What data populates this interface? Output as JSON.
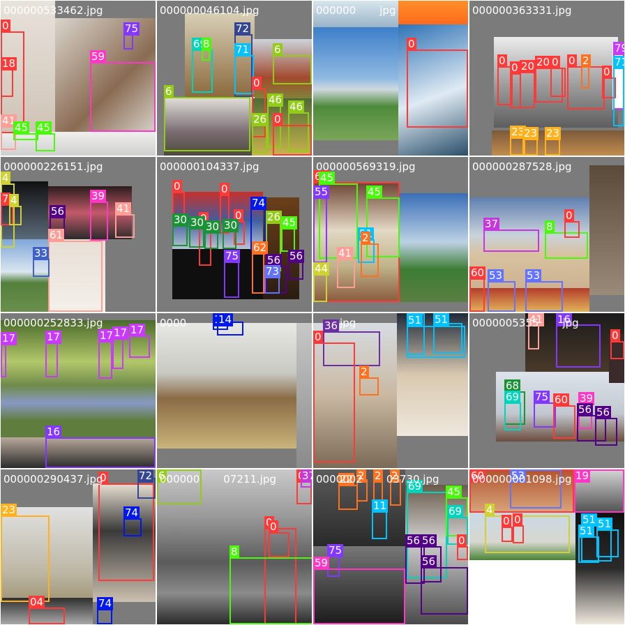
{
  "palette": {
    "0": "#ff3838",
    "2": "#ff701f",
    "4": "#cfd231",
    "6": "#92cc17",
    "8": "#48f90a",
    "14": "#0018ec",
    "16": "#8438ff",
    "17": "#cb38ff",
    "19": "#ff37c7",
    "22": "#ff701f",
    "23": "#ffb21d",
    "26": "#92cc17",
    "30": "#1a9334",
    "33": "#3d61c6",
    "36": "#6b2fa1",
    "37": "#c837de",
    "39": "#ff37c7",
    "41": "#ff9d97",
    "44": "#cfd231",
    "45": "#48f90a",
    "46": "#92cc17",
    "51": "#00c2ff",
    "53": "#6473ff",
    "55": "#8438ff",
    "56": "#520085",
    "59": "#ff37c7",
    "60": "#ff3838",
    "61": "#ff9d97",
    "62": "#ff701f",
    "68": "#1a9334",
    "69": "#00d4bb",
    "71": "#00c2ff",
    "72": "#344593",
    "73": "#6473ff",
    "74": "#0018ec",
    "75": "#8438ff",
    "79": "#cb38ff"
  },
  "tiles": [
    {
      "filename": "000000533462.jpg",
      "labels": [
        {
          "cls": "0",
          "text": "0"
        },
        {
          "cls": "75",
          "text": "75"
        },
        {
          "cls": "59",
          "text": "59"
        },
        {
          "cls": "41",
          "text": "41"
        },
        {
          "cls": "45",
          "text": "45"
        },
        {
          "cls": "45",
          "text": "45"
        },
        {
          "cls": "18",
          "text": "18"
        }
      ]
    },
    {
      "filename": "000000046104.jpg",
      "labels": [
        {
          "cls": "72",
          "text": "72"
        },
        {
          "cls": "71",
          "text": "71"
        },
        {
          "cls": "69",
          "text": "69"
        },
        {
          "cls": "8",
          "text": "8"
        },
        {
          "cls": "6",
          "text": "6"
        },
        {
          "cls": "6",
          "text": "6"
        },
        {
          "cls": "0",
          "text": "0"
        },
        {
          "cls": "46",
          "text": "46"
        },
        {
          "cls": "46",
          "text": "46"
        },
        {
          "cls": "26",
          "text": "26"
        },
        {
          "cls": "0",
          "text": "0"
        }
      ]
    },
    {
      "filename": "000000",
      "filename_tail": "jpg",
      "labels": [
        {
          "cls": "0",
          "text": "0"
        }
      ]
    },
    {
      "filename": "000000363331.jpg",
      "labels": [
        {
          "cls": "0",
          "text": "0"
        },
        {
          "cls": "0",
          "text": "0"
        },
        {
          "cls": "0",
          "text": "20"
        },
        {
          "cls": "0",
          "text": "20"
        },
        {
          "cls": "0",
          "text": "0"
        },
        {
          "cls": "0",
          "text": "0"
        },
        {
          "cls": "2",
          "text": "2"
        },
        {
          "cls": "0",
          "text": "0"
        },
        {
          "cls": "79",
          "text": "79"
        },
        {
          "cls": "71",
          "text": "71"
        },
        {
          "cls": "23",
          "text": "23"
        },
        {
          "cls": "23",
          "text": "23"
        },
        {
          "cls": "23",
          "text": "23"
        }
      ]
    },
    {
      "filename": "000000226151.jpg",
      "labels": [
        {
          "cls": "4",
          "text": "4"
        },
        {
          "cls": "41",
          "text": "41"
        },
        {
          "cls": "39",
          "text": "39"
        },
        {
          "cls": "56",
          "text": "56"
        },
        {
          "cls": "61",
          "text": "61"
        },
        {
          "cls": "33",
          "text": "33"
        },
        {
          "cls": "7",
          "text": "7"
        },
        {
          "cls": "4",
          "text": "4"
        }
      ]
    },
    {
      "filename": "000000104337.jpg",
      "labels": [
        {
          "cls": "0",
          "text": "0"
        },
        {
          "cls": "0",
          "text": "0"
        },
        {
          "cls": "74",
          "text": "74"
        },
        {
          "cls": "0",
          "text": "0"
        },
        {
          "cls": "0",
          "text": "0"
        },
        {
          "cls": "26",
          "text": "26"
        },
        {
          "cls": "45",
          "text": "45"
        },
        {
          "cls": "30",
          "text": "30"
        },
        {
          "cls": "30",
          "text": "30"
        },
        {
          "cls": "30",
          "text": "30"
        },
        {
          "cls": "30",
          "text": "30"
        },
        {
          "cls": "75",
          "text": "75"
        },
        {
          "cls": "62",
          "text": "62"
        },
        {
          "cls": "56",
          "text": "56"
        },
        {
          "cls": "56",
          "text": "56"
        },
        {
          "cls": "73",
          "text": "73"
        }
      ]
    },
    {
      "filename": "000000569319.jpg",
      "labels": [
        {
          "cls": "60",
          "text": "60"
        },
        {
          "cls": "45",
          "text": "45"
        },
        {
          "cls": "45",
          "text": "45"
        },
        {
          "cls": "55",
          "text": "55"
        },
        {
          "cls": "51",
          "text": "51"
        },
        {
          "cls": "2",
          "text": "2"
        },
        {
          "cls": "41",
          "text": "41"
        },
        {
          "cls": "44",
          "text": "44"
        }
      ]
    },
    {
      "filename": "000000287528.jpg",
      "labels": [
        {
          "cls": "37",
          "text": "37"
        },
        {
          "cls": "8",
          "text": "8"
        },
        {
          "cls": "0",
          "text": "0"
        },
        {
          "cls": "60",
          "text": "60"
        },
        {
          "cls": "53",
          "text": "53"
        },
        {
          "cls": "53",
          "text": "53"
        }
      ]
    },
    {
      "filename": "000000252833.jpg",
      "labels": [
        {
          "cls": "17",
          "text": "17"
        },
        {
          "cls": "17",
          "text": "17"
        },
        {
          "cls": "17",
          "text": "17"
        },
        {
          "cls": "17",
          "text": "17"
        },
        {
          "cls": "17",
          "text": "17"
        },
        {
          "cls": "16",
          "text": "16"
        }
      ]
    },
    {
      "filename": "0000",
      "labels": [
        {
          "cls": "14",
          "text": "14"
        },
        {
          "cls": "14",
          "text": "14"
        }
      ]
    },
    {
      "filename": "",
      "filename_tail": "jpg",
      "labels": [
        {
          "cls": "36",
          "text": "36"
        },
        {
          "cls": "0",
          "text": "0"
        },
        {
          "cls": "2",
          "text": "2"
        },
        {
          "cls": "51",
          "text": "51"
        },
        {
          "cls": "51",
          "text": "51"
        },
        {
          "cls": "51",
          "text": "51"
        }
      ]
    },
    {
      "filename": "0000005355",
      "filename_tail": "jpg",
      "labels": [
        {
          "cls": "41",
          "text": "41"
        },
        {
          "cls": "16",
          "text": "16"
        },
        {
          "cls": "68",
          "text": "68"
        },
        {
          "cls": "69",
          "text": "69"
        },
        {
          "cls": "75",
          "text": "75"
        },
        {
          "cls": "60",
          "text": "60"
        },
        {
          "cls": "39",
          "text": "39"
        },
        {
          "cls": "56",
          "text": "56"
        },
        {
          "cls": "56",
          "text": "56"
        },
        {
          "cls": "0",
          "text": "0"
        }
      ]
    },
    {
      "filename": "000000290437.jpg",
      "labels": [
        {
          "cls": "0",
          "text": "0"
        },
        {
          "cls": "72",
          "text": "72"
        },
        {
          "cls": "74",
          "text": "74"
        },
        {
          "cls": "23",
          "text": "23"
        },
        {
          "cls": "74",
          "text": "74"
        },
        {
          "cls": "0",
          "text": "04"
        }
      ]
    },
    {
      "filename": "000000",
      "filename_tail": "07211.jpg",
      "labels": [
        {
          "cls": "6",
          "text": "6"
        },
        {
          "cls": "0",
          "text": "0"
        },
        {
          "cls": "0",
          "text": "0"
        },
        {
          "cls": "8",
          "text": "8"
        },
        {
          "cls": "0",
          "text": "0"
        },
        {
          "cls": "37",
          "text": "37"
        }
      ]
    },
    {
      "filename": "0000002",
      "filename_tail": "03730.jpg",
      "labels": [
        {
          "cls": "22",
          "text": "22"
        },
        {
          "cls": "2",
          "text": "2"
        },
        {
          "cls": "2",
          "text": "2"
        },
        {
          "cls": "2",
          "text": "2"
        },
        {
          "cls": "69",
          "text": "69"
        },
        {
          "cls": "71",
          "text": "11"
        },
        {
          "cls": "45",
          "text": "45"
        },
        {
          "cls": "69",
          "text": "69"
        },
        {
          "cls": "75",
          "text": "75"
        },
        {
          "cls": "59",
          "text": "59"
        },
        {
          "cls": "56",
          "text": "56"
        },
        {
          "cls": "56",
          "text": "56"
        },
        {
          "cls": "56",
          "text": "56"
        },
        {
          "cls": "0",
          "text": "0"
        }
      ]
    },
    {
      "filename": "000000001098.jpg",
      "labels": [
        {
          "cls": "60",
          "text": "60"
        },
        {
          "cls": "53",
          "text": "53"
        },
        {
          "cls": "19",
          "text": "19"
        },
        {
          "cls": "4",
          "text": "4"
        },
        {
          "cls": "0",
          "text": "0"
        },
        {
          "cls": "0",
          "text": "0"
        },
        {
          "cls": "51",
          "text": "51"
        },
        {
          "cls": "51",
          "text": "51"
        },
        {
          "cls": "51",
          "text": "51"
        }
      ]
    }
  ]
}
